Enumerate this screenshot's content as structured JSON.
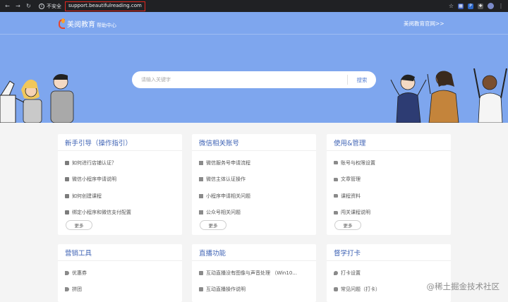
{
  "browser": {
    "security_label": "不安全",
    "url": "support.beautifulreading.com"
  },
  "header": {
    "brand_name": "美阅教育",
    "brand_sub": "帮助中心",
    "official_link": "美阅教育官网>>"
  },
  "search": {
    "placeholder": "请输入关键字",
    "button_label": "搜索"
  },
  "cards": {
    "c1": {
      "title": "新手引导（操作指引）",
      "items": [
        "如何进行店铺认证？",
        "微信小程序申请说明",
        "如何创建课程",
        "绑定小程序和微信支付配置"
      ],
      "more": "更多"
    },
    "c2": {
      "title": "微信相关账号",
      "items": [
        "微信服务号申请流程",
        "微信主体认证操作",
        "小程序申请相关问题",
        "公众号相关问题"
      ],
      "more": "更多"
    },
    "c3": {
      "title": "使用&管理",
      "items": [
        "账号与权限设置",
        "文章管理",
        "课程资料",
        "闯关课程说明"
      ],
      "more": "更多"
    },
    "c4": {
      "title": "营销工具",
      "items": [
        "优惠券",
        "拼团"
      ]
    },
    "c5": {
      "title": "直播功能",
      "items": [
        "互动直播没有图像与声音处理 （Win10...",
        "互动直播操作说明"
      ]
    },
    "c6": {
      "title": "督学打卡",
      "items": [
        "打卡设置",
        "常见问题（打卡）"
      ]
    }
  },
  "watermark": "@稀土掘金技术社区",
  "colors": {
    "hero": "#7ea6ee",
    "card_title": "#3f63b5",
    "url_highlight": "#e2261e"
  }
}
